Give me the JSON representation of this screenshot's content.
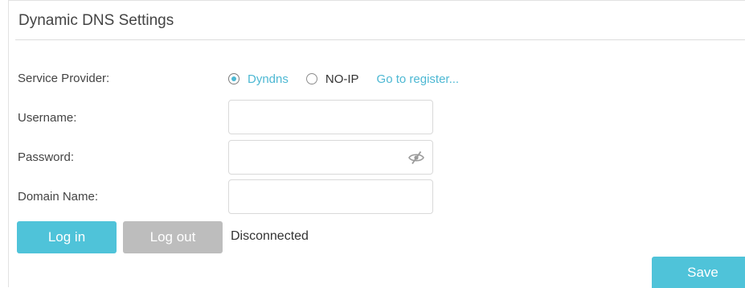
{
  "title": "Dynamic DNS Settings",
  "service_provider": {
    "label": "Service Provider:",
    "options": [
      {
        "label": "Dyndns",
        "selected": true
      },
      {
        "label": "NO-IP",
        "selected": false
      }
    ],
    "register_link": "Go to register..."
  },
  "username": {
    "label": "Username:",
    "value": ""
  },
  "password": {
    "label": "Password:",
    "value": "",
    "icon": "eye-slash-icon"
  },
  "domain_name": {
    "label": "Domain Name:",
    "value": ""
  },
  "actions": {
    "login_label": "Log in",
    "logout_label": "Log out",
    "status": "Disconnected",
    "save_label": "Save"
  },
  "colors": {
    "accent": "#4fc3d9",
    "disabled": "#bdbdbd"
  }
}
